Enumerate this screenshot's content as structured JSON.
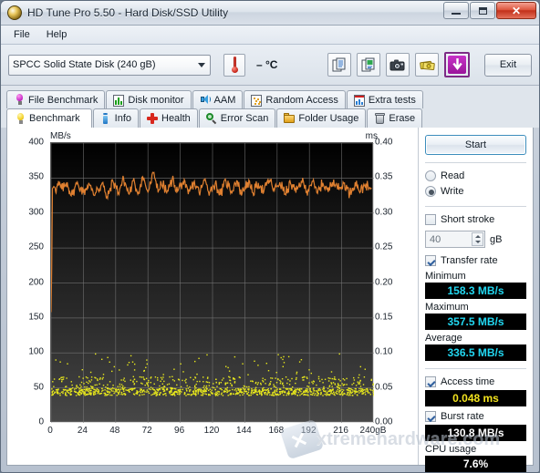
{
  "window": {
    "title": "HD Tune Pro 5.50 - Hard Disk/SSD Utility",
    "icon": "hdtune-logo-icon",
    "minimize_label": "",
    "maximize_label": "",
    "close_label": "✕"
  },
  "menu": {
    "items": [
      "File",
      "Help"
    ]
  },
  "toolbar": {
    "drive": "SPCC Solid State Disk (240 gB)",
    "temperature": "– °C",
    "buttons": [
      {
        "name": "copy-button",
        "icon": "copy-icon"
      },
      {
        "name": "copy-image-button",
        "icon": "copy-image-icon"
      },
      {
        "name": "screenshot-button",
        "icon": "camera-icon"
      },
      {
        "name": "register-button",
        "icon": "money-icon"
      },
      {
        "name": "download-button",
        "icon": "download-arrow-icon"
      }
    ],
    "exit_label": "Exit"
  },
  "tabs": {
    "row1": [
      {
        "label": "File Benchmark",
        "icon": "bulb-magenta-icon"
      },
      {
        "label": "Disk monitor",
        "icon": "bar-chart-icon"
      },
      {
        "label": "AAM",
        "icon": "speaker-icon"
      },
      {
        "label": "Random Access",
        "icon": "random-dots-icon"
      },
      {
        "label": "Extra tests",
        "icon": "extra-tests-icon"
      }
    ],
    "row2": [
      {
        "label": "Benchmark",
        "icon": "bulb-yellow-icon",
        "active": true
      },
      {
        "label": "Info",
        "icon": "info-icon",
        "active": false
      },
      {
        "label": "Health",
        "icon": "cross-icon",
        "active": false
      },
      {
        "label": "Error Scan",
        "icon": "magnifier-icon",
        "active": false
      },
      {
        "label": "Folder Usage",
        "icon": "folder-icon",
        "active": false
      },
      {
        "label": "Erase",
        "icon": "trash-icon",
        "active": false
      }
    ]
  },
  "panel": {
    "start_label": "Start",
    "mode": {
      "read_label": "Read",
      "write_label": "Write",
      "selected": "Write"
    },
    "short_stroke": {
      "label": "Short stroke",
      "checked": false,
      "value": "40",
      "unit": "gB"
    },
    "transfer_rate": {
      "label": "Transfer rate",
      "checked": true
    },
    "minimum_label": "Minimum",
    "minimum_value": "158.3 MB/s",
    "maximum_label": "Maximum",
    "maximum_value": "357.5 MB/s",
    "average_label": "Average",
    "average_value": "336.5 MB/s",
    "access_time": {
      "label": "Access time",
      "checked": true,
      "value": "0.048 ms"
    },
    "burst_rate": {
      "label": "Burst rate",
      "checked": true,
      "value": "130.8 MB/s"
    },
    "cpu_usage_label": "CPU usage",
    "cpu_usage_value": "7.6%"
  },
  "watermark": {
    "text": "xtremehardware.com"
  },
  "colors": {
    "transfer_line": "#e08030",
    "access_dots": "#e8e81c",
    "value_cyan": "#22d8f2",
    "value_yellow": "#f2e31e",
    "value_white": "#ffffff",
    "plot_background_top": "#000000",
    "plot_background_bottom": "#474747",
    "grid": "#7a7a7a"
  },
  "chart_data": {
    "type": "line",
    "title": "",
    "xlabel": "gB",
    "ylabel": "MB/s",
    "y2label": "ms",
    "ylim": [
      0,
      400
    ],
    "y2lim": [
      0,
      0.4
    ],
    "xlim": [
      0,
      240
    ],
    "grid": true,
    "yticks": [
      0,
      50,
      100,
      150,
      200,
      250,
      300,
      350,
      400
    ],
    "y2ticks": [
      "0.00",
      "0.05",
      "0.10",
      "0.15",
      "0.20",
      "0.25",
      "0.30",
      "0.35",
      "0.40"
    ],
    "xticks": [
      0,
      24,
      48,
      72,
      96,
      120,
      144,
      168,
      192,
      216,
      240
    ],
    "xtick_last_label": "240gB",
    "series": [
      {
        "name": "Transfer rate",
        "type": "line",
        "color": "#e08030",
        "axis": "left",
        "units": "MB/s",
        "x": [
          0,
          0.5,
          1,
          2,
          3,
          4,
          5,
          6,
          8,
          10,
          12,
          14,
          16,
          18,
          20,
          22,
          24,
          26,
          28,
          30,
          32,
          34,
          36,
          38,
          40,
          42,
          44,
          46,
          48,
          50,
          52,
          54,
          56,
          58,
          60,
          62,
          64,
          66,
          68,
          70,
          72,
          74,
          76,
          78,
          80,
          82,
          84,
          86,
          88,
          90,
          92,
          94,
          96,
          98,
          100,
          102,
          104,
          106,
          108,
          110,
          112,
          114,
          116,
          118,
          120,
          122,
          124,
          126,
          128,
          130,
          132,
          134,
          136,
          138,
          140,
          142,
          144,
          146,
          148,
          150,
          152,
          154,
          156,
          158,
          160,
          162,
          164,
          166,
          168,
          170,
          172,
          174,
          176,
          178,
          180,
          182,
          184,
          186,
          188,
          190,
          192,
          194,
          196,
          198,
          200,
          202,
          204,
          206,
          208,
          210,
          212,
          214,
          216,
          218,
          220,
          222,
          224,
          226,
          228,
          230,
          232,
          234,
          236,
          238,
          240
        ],
        "values": [
          158.3,
          222,
          335,
          338,
          336,
          334,
          339,
          341,
          334,
          338,
          344,
          330,
          326,
          339,
          341,
          336,
          329,
          335,
          343,
          333,
          325,
          337,
          334,
          343,
          330,
          321,
          336,
          345,
          339,
          329,
          340,
          348,
          337,
          327,
          339,
          344,
          330,
          336,
          352,
          341,
          330,
          342,
          357.5,
          345,
          333,
          341,
          338,
          329,
          337,
          348,
          340,
          331,
          339,
          344,
          336,
          327,
          335,
          343,
          338,
          329,
          336,
          347,
          340,
          330,
          338,
          342,
          334,
          326,
          337,
          345,
          339,
          331,
          340,
          346,
          335,
          328,
          338,
          344,
          337,
          329,
          336,
          343,
          338,
          330,
          339,
          347,
          341,
          332,
          338,
          344,
          336,
          327,
          335,
          342,
          337,
          329,
          338,
          346,
          340,
          331,
          339,
          345,
          336,
          328,
          337,
          343,
          338,
          330,
          340,
          348,
          342,
          333,
          338,
          343,
          335,
          327,
          336,
          344,
          339,
          331,
          337,
          342,
          334,
          336
        ]
      },
      {
        "name": "Access time",
        "type": "scatter",
        "color": "#e8e81c",
        "axis": "right",
        "units": "ms",
        "average": 0.048,
        "cluster_center": 0.045,
        "cluster_spread": 0.008,
        "outlier_max": 0.1
      }
    ],
    "results": {
      "minimum_mbs": 158.3,
      "maximum_mbs": 357.5,
      "average_mbs": 336.5,
      "access_time_ms": 0.048,
      "burst_rate_mbs": 130.8,
      "cpu_usage_percent": 7.6
    }
  }
}
